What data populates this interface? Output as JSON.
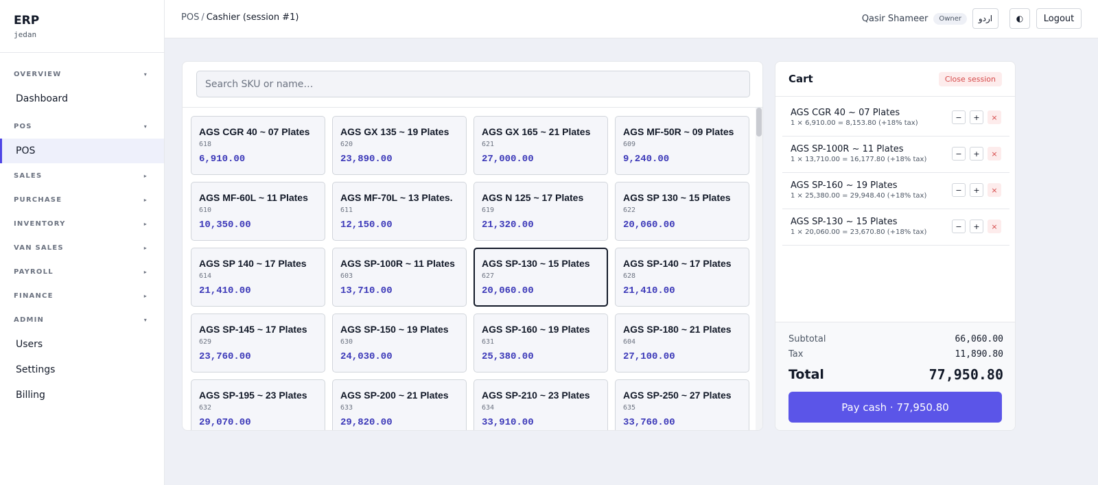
{
  "brand": {
    "title": "ERP",
    "subtitle": "jedan"
  },
  "sidebar": {
    "overview": {
      "label": "OVERVIEW",
      "caret": "▾",
      "items": [
        "Dashboard"
      ]
    },
    "pos": {
      "label": "POS",
      "caret": "▾",
      "items": [
        "POS"
      ]
    },
    "sales": {
      "label": "SALES",
      "caret": "▸"
    },
    "purchase": {
      "label": "PURCHASE",
      "caret": "▸"
    },
    "inventory": {
      "label": "INVENTORY",
      "caret": "▸"
    },
    "van_sales": {
      "label": "VAN SALES",
      "caret": "▸"
    },
    "payroll": {
      "label": "PAYROLL",
      "caret": "▸"
    },
    "finance": {
      "label": "FINANCE",
      "caret": "▸"
    },
    "admin": {
      "label": "ADMIN",
      "caret": "▾",
      "items": [
        "Users",
        "Settings",
        "Billing"
      ]
    }
  },
  "header": {
    "crumb_root": "POS",
    "crumb_sep": "/",
    "crumb_current": "Cashier (session #1)",
    "user_name": "Qasir Shameer",
    "user_role": "Owner",
    "lang_label": "اردو",
    "theme_icon": "◐",
    "logout_label": "Logout"
  },
  "search": {
    "placeholder": "Search SKU or name…",
    "value": ""
  },
  "products": [
    {
      "name": "AGS CGR 40 ~ 07 Plates",
      "sku": "618",
      "price": "6,910.00"
    },
    {
      "name": "AGS GX 135 ~ 19 Plates",
      "sku": "620",
      "price": "23,890.00"
    },
    {
      "name": "AGS GX 165 ~ 21 Plates",
      "sku": "621",
      "price": "27,000.00"
    },
    {
      "name": "AGS MF-50R ~ 09 Plates",
      "sku": "609",
      "price": "9,240.00"
    },
    {
      "name": "AGS MF-60L ~ 11 Plates",
      "sku": "610",
      "price": "10,350.00"
    },
    {
      "name": "AGS MF-70L ~ 13 Plates.",
      "sku": "611",
      "price": "12,150.00"
    },
    {
      "name": "AGS N 125 ~ 17 Plates",
      "sku": "619",
      "price": "21,320.00"
    },
    {
      "name": "AGS SP 130 ~ 15 Plates",
      "sku": "622",
      "price": "20,060.00"
    },
    {
      "name": "AGS SP 140 ~ 17 Plates",
      "sku": "614",
      "price": "21,410.00"
    },
    {
      "name": "AGS SP-100R ~ 11 Plates",
      "sku": "603",
      "price": "13,710.00"
    },
    {
      "name": "AGS SP-130 ~ 15 Plates",
      "sku": "627",
      "price": "20,060.00"
    },
    {
      "name": "AGS SP-140 ~ 17 Plates",
      "sku": "628",
      "price": "21,410.00"
    },
    {
      "name": "AGS SP-145 ~ 17 Plates",
      "sku": "629",
      "price": "23,760.00"
    },
    {
      "name": "AGS SP-150 ~ 19 Plates",
      "sku": "630",
      "price": "24,030.00"
    },
    {
      "name": "AGS SP-160 ~ 19 Plates",
      "sku": "631",
      "price": "25,380.00"
    },
    {
      "name": "AGS SP-180 ~ 21 Plates",
      "sku": "604",
      "price": "27,100.00"
    },
    {
      "name": "AGS SP-195 ~ 23 Plates",
      "sku": "632",
      "price": "29,070.00"
    },
    {
      "name": "AGS SP-200 ~ 21 Plates",
      "sku": "633",
      "price": "29,820.00"
    },
    {
      "name": "AGS SP-210 ~ 23 Plates",
      "sku": "634",
      "price": "33,910.00"
    },
    {
      "name": "AGS SP-250 ~ 27 Plates",
      "sku": "635",
      "price": "33,760.00"
    }
  ],
  "cart": {
    "title": "Cart",
    "close_label": "Close session",
    "minus": "−",
    "plus": "+",
    "remove": "×",
    "lines": [
      {
        "name": "AGS CGR 40 ~ 07 Plates",
        "calc": "1 × 6,910.00 = 8,153.80 (+18% tax)"
      },
      {
        "name": "AGS SP-100R ~ 11 Plates",
        "calc": "1 × 13,710.00 = 16,177.80 (+18% tax)"
      },
      {
        "name": "AGS SP-160 ~ 19 Plates",
        "calc": "1 × 25,380.00 = 29,948.40 (+18% tax)"
      },
      {
        "name": "AGS SP-130 ~ 15 Plates",
        "calc": "1 × 20,060.00 = 23,670.80 (+18% tax)"
      }
    ]
  },
  "totals": {
    "subtotal_label": "Subtotal",
    "subtotal": "66,060.00",
    "tax_label": "Tax",
    "tax": "11,890.80",
    "total_label": "Total",
    "total": "77,950.80",
    "pay_label": "Pay cash · 77,950.80"
  },
  "colors": {
    "accent": "#5b55e8",
    "price": "#3b38b8",
    "danger": "#d54848",
    "active_bg": "#eef0fb"
  }
}
